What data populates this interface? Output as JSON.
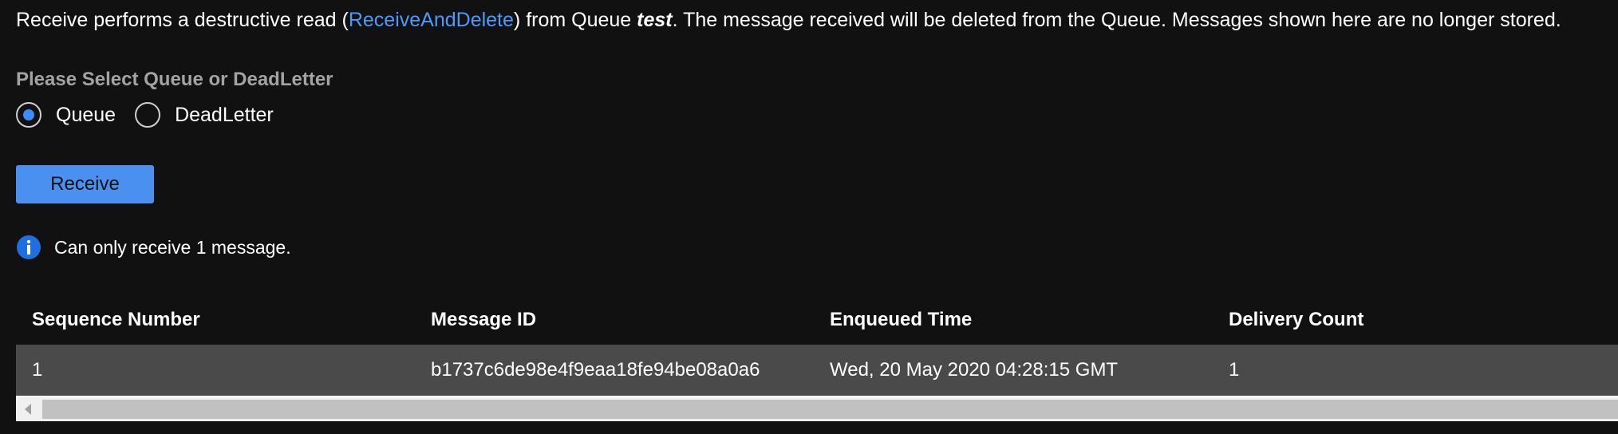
{
  "intro": {
    "prefix": "Receive performs a destructive read (",
    "link": "ReceiveAndDelete",
    "middle": ") from Queue ",
    "queue_name": "test",
    "suffix": ". The message received will be deleted from the Queue. Messages shown here are no longer stored."
  },
  "selector": {
    "label": "Please Select Queue or DeadLetter",
    "options": [
      {
        "label": "Queue",
        "selected": true
      },
      {
        "label": "DeadLetter",
        "selected": false
      }
    ]
  },
  "receive_button": {
    "label": "Receive"
  },
  "info": {
    "icon": "info-icon",
    "text": "Can only receive 1 message."
  },
  "table": {
    "columns": [
      "Sequence Number",
      "Message ID",
      "Enqueued Time",
      "Delivery Count"
    ],
    "rows": [
      [
        "1",
        "b1737c6de98e4f9eaa18fe94be08a0a6",
        "Wed, 20 May 2020 04:28:15 GMT",
        "1"
      ]
    ]
  },
  "colors": {
    "background": "#111111",
    "accent": "#4a90f0",
    "link": "#4b9bff",
    "row_background": "#4a4a4a"
  }
}
